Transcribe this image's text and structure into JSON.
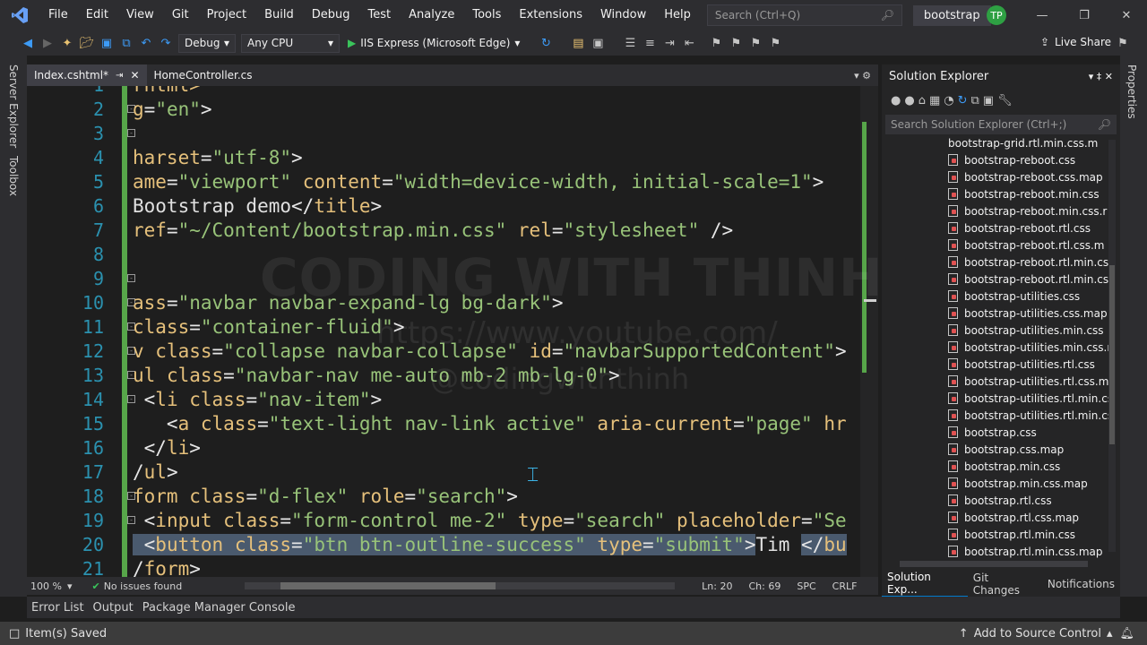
{
  "menu": [
    "File",
    "Edit",
    "View",
    "Git",
    "Project",
    "Build",
    "Debug",
    "Test",
    "Analyze",
    "Tools",
    "Extensions",
    "Window",
    "Help"
  ],
  "search": {
    "placeholder": "Search (Ctrl+Q)"
  },
  "solution_name": "bootstrap",
  "user_initials": "TP",
  "toolbar": {
    "config": "Debug",
    "platform": "Any CPU",
    "run_target": "IIS Express (Microsoft Edge)",
    "live_share": "Live Share"
  },
  "left_tabs": [
    "Server Explorer",
    "Toolbox"
  ],
  "right_tabs": [
    "Properties"
  ],
  "doc_tabs": [
    {
      "label": "Index.cshtml*",
      "active": true
    },
    {
      "label": "HomeController.cs",
      "active": false
    }
  ],
  "code_lines": [
    {
      "n": "1",
      "segs": [
        [
          "c-tag",
          "rhtml>"
        ]
      ]
    },
    {
      "n": "2",
      "segs": [
        [
          "c-attr",
          "g"
        ],
        [
          "c-br",
          "="
        ],
        [
          "c-str",
          "\"en\""
        ],
        [
          "c-br",
          ">"
        ]
      ]
    },
    {
      "n": "3",
      "segs": []
    },
    {
      "n": "4",
      "segs": [
        [
          "c-attr",
          "harset"
        ],
        [
          "c-br",
          "="
        ],
        [
          "c-str",
          "\"utf-8\""
        ],
        [
          "c-br",
          ">"
        ]
      ]
    },
    {
      "n": "5",
      "segs": [
        [
          "c-attr",
          "ame"
        ],
        [
          "c-br",
          "="
        ],
        [
          "c-str",
          "\"viewport\""
        ],
        [
          "c-br",
          " "
        ],
        [
          "c-attr",
          "content"
        ],
        [
          "c-br",
          "="
        ],
        [
          "c-str",
          "\"width=device-width, initial-scale=1\""
        ],
        [
          "c-br",
          ">"
        ]
      ]
    },
    {
      "n": "6",
      "segs": [
        [
          "txt",
          "Bootstrap demo"
        ],
        [
          "c-br",
          "</"
        ],
        [
          "c-tag",
          "title"
        ],
        [
          "c-br",
          ">"
        ]
      ]
    },
    {
      "n": "7",
      "segs": [
        [
          "c-attr",
          "ref"
        ],
        [
          "c-br",
          "="
        ],
        [
          "c-str",
          "\"~/Content/bootstrap.min.css\""
        ],
        [
          "c-br",
          " "
        ],
        [
          "c-attr",
          "rel"
        ],
        [
          "c-br",
          "="
        ],
        [
          "c-str",
          "\"stylesheet\""
        ],
        [
          "c-br",
          " />"
        ]
      ]
    },
    {
      "n": "8",
      "segs": []
    },
    {
      "n": "9",
      "segs": []
    },
    {
      "n": "10",
      "segs": [
        [
          "c-attr",
          "ass"
        ],
        [
          "c-br",
          "="
        ],
        [
          "c-str",
          "\"navbar navbar-expand-lg bg-dark\""
        ],
        [
          "c-br",
          ">"
        ]
      ]
    },
    {
      "n": "11",
      "segs": [
        [
          "c-attr",
          "class"
        ],
        [
          "c-br",
          "="
        ],
        [
          "c-str",
          "\"container-fluid\""
        ],
        [
          "c-br",
          ">"
        ]
      ]
    },
    {
      "n": "12",
      "segs": [
        [
          "c-tag",
          "v "
        ],
        [
          "c-attr",
          "class"
        ],
        [
          "c-br",
          "="
        ],
        [
          "c-str",
          "\"collapse navbar-collapse\""
        ],
        [
          "c-br",
          " "
        ],
        [
          "c-attr",
          "id"
        ],
        [
          "c-br",
          "="
        ],
        [
          "c-str",
          "\"navbarSupportedContent\""
        ],
        [
          "c-br",
          ">"
        ]
      ]
    },
    {
      "n": "13",
      "segs": [
        [
          "c-tag",
          "ul "
        ],
        [
          "c-attr",
          "class"
        ],
        [
          "c-br",
          "="
        ],
        [
          "c-str",
          "\"navbar-nav me-auto mb-2 mb-lg-0\""
        ],
        [
          "c-br",
          ">"
        ]
      ]
    },
    {
      "n": "14",
      "segs": [
        [
          "c-br",
          " <"
        ],
        [
          "c-tag",
          "li "
        ],
        [
          "c-attr",
          "class"
        ],
        [
          "c-br",
          "="
        ],
        [
          "c-str",
          "\"nav-item\""
        ],
        [
          "c-br",
          ">"
        ]
      ]
    },
    {
      "n": "15",
      "segs": [
        [
          "c-br",
          "   <"
        ],
        [
          "c-tag",
          "a "
        ],
        [
          "c-attr",
          "class"
        ],
        [
          "c-br",
          "="
        ],
        [
          "c-str",
          "\"text-light nav-link active\""
        ],
        [
          "c-br",
          " "
        ],
        [
          "c-attr",
          "aria-current"
        ],
        [
          "c-br",
          "="
        ],
        [
          "c-str",
          "\"page\""
        ],
        [
          "c-br",
          " "
        ],
        [
          "c-attr",
          "hr"
        ]
      ]
    },
    {
      "n": "16",
      "segs": [
        [
          "c-br",
          " </"
        ],
        [
          "c-tag",
          "li"
        ],
        [
          "c-br",
          ">"
        ]
      ]
    },
    {
      "n": "17",
      "segs": [
        [
          "c-br",
          "/"
        ],
        [
          "c-tag",
          "ul"
        ],
        [
          "c-br",
          ">"
        ]
      ]
    },
    {
      "n": "18",
      "segs": [
        [
          "c-tag",
          "form "
        ],
        [
          "c-attr",
          "class"
        ],
        [
          "c-br",
          "="
        ],
        [
          "c-str",
          "\"d-flex\""
        ],
        [
          "c-br",
          " "
        ],
        [
          "c-attr",
          "role"
        ],
        [
          "c-br",
          "="
        ],
        [
          "c-str",
          "\"search\""
        ],
        [
          "c-br",
          ">"
        ]
      ]
    },
    {
      "n": "19",
      "segs": [
        [
          "c-br",
          " <"
        ],
        [
          "c-tag",
          "input "
        ],
        [
          "c-attr",
          "class"
        ],
        [
          "c-br",
          "="
        ],
        [
          "c-str",
          "\"form-control me-2\""
        ],
        [
          "c-br",
          " "
        ],
        [
          "c-attr",
          "type"
        ],
        [
          "c-br",
          "="
        ],
        [
          "c-str",
          "\"search\""
        ],
        [
          "c-br",
          " "
        ],
        [
          "c-attr",
          "placeholder"
        ],
        [
          "c-br",
          "="
        ],
        [
          "c-str",
          "\"Se"
        ]
      ]
    },
    {
      "n": "20",
      "segs": [
        [
          "c-br sel",
          " <"
        ],
        [
          "c-tag sel",
          "button "
        ],
        [
          "c-attr sel",
          "class"
        ],
        [
          "c-br sel",
          "="
        ],
        [
          "c-str sel",
          "\"btn btn-outline-success\""
        ],
        [
          "c-br sel",
          " "
        ],
        [
          "c-attr sel",
          "type"
        ],
        [
          "c-br sel",
          "="
        ],
        [
          "c-str sel",
          "\"submit\""
        ],
        [
          "c-br sel",
          ">"
        ],
        [
          "txt",
          "Tim "
        ],
        [
          "c-br sel",
          "</"
        ],
        [
          "c-tag sel",
          "bu"
        ]
      ]
    },
    {
      "n": "21",
      "segs": [
        [
          "c-br",
          "/"
        ],
        [
          "c-tag",
          "form"
        ],
        [
          "c-br",
          ">"
        ]
      ]
    }
  ],
  "watermark": {
    "line1": "CODING WITH THINH",
    "line2": "https://www.youtube.com/",
    "line3": "@codingwiththinh"
  },
  "editor_status": {
    "zoom": "100 %",
    "issues": "No issues found",
    "ln": "Ln: 20",
    "ch": "Ch: 69",
    "spc": "SPC",
    "crlf": "CRLF"
  },
  "solution_explorer": {
    "title": "Solution Explorer",
    "search_placeholder": "Search Solution Explorer (Ctrl+;)",
    "files": [
      "bootstrap-grid.rtl.min.css.m",
      "bootstrap-reboot.css",
      "bootstrap-reboot.css.map",
      "bootstrap-reboot.min.css",
      "bootstrap-reboot.min.css.r",
      "bootstrap-reboot.rtl.css",
      "bootstrap-reboot.rtl.css.m",
      "bootstrap-reboot.rtl.min.cs",
      "bootstrap-reboot.rtl.min.cs",
      "bootstrap-utilities.css",
      "bootstrap-utilities.css.map",
      "bootstrap-utilities.min.css",
      "bootstrap-utilities.min.css.r",
      "bootstrap-utilities.rtl.css",
      "bootstrap-utilities.rtl.css.m",
      "bootstrap-utilities.rtl.min.cs",
      "bootstrap-utilities.rtl.min.cs",
      "bootstrap.css",
      "bootstrap.css.map",
      "bootstrap.min.css",
      "bootstrap.min.css.map",
      "bootstrap.rtl.css",
      "bootstrap.rtl.css.map",
      "bootstrap.rtl.min.css",
      "bootstrap.rtl.min.css.map"
    ],
    "tabs": [
      "Solution Exp...",
      "Git Changes",
      "Notifications"
    ]
  },
  "bottom_tabs": [
    "Error List",
    "Output",
    "Package Manager Console"
  ],
  "status": {
    "left": "Item(s) Saved",
    "source_control": "Add to Source Control"
  },
  "colors": {
    "accent": "#007acc",
    "margin_green": "#57a64a",
    "avatar_green": "#2ea043"
  }
}
